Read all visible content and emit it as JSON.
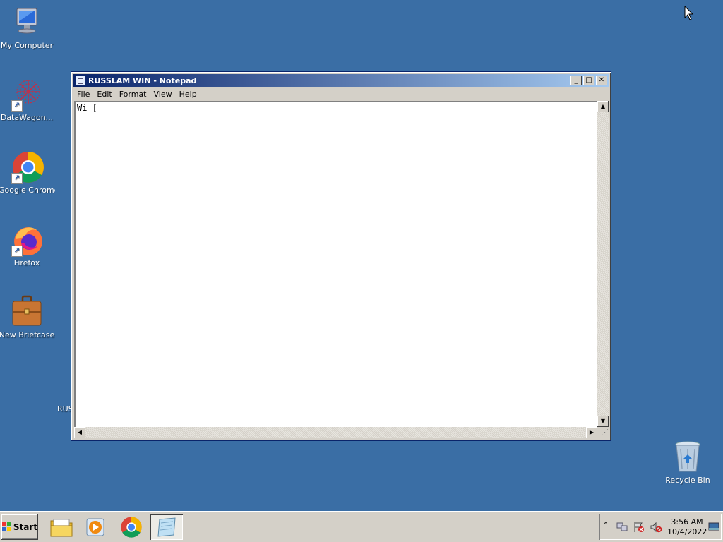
{
  "desktop": {
    "icons": [
      {
        "label": "My Computer",
        "icon": "computer-icon"
      },
      {
        "label": "DataWagon...",
        "icon": "datawagon-icon"
      },
      {
        "label": "Google Chrome",
        "icon": "chrome-icon"
      },
      {
        "label": "Firefox",
        "icon": "firefox-icon"
      },
      {
        "label": "New Briefcase",
        "icon": "briefcase-icon"
      },
      {
        "label": "Recycle Bin",
        "icon": "recycle-bin-icon"
      }
    ],
    "partial_label": "RUS",
    "background_color": "#3a6ea5"
  },
  "notepad": {
    "title": "RUSSLAM WIN - Notepad",
    "menu": [
      "File",
      "Edit",
      "Format",
      "View",
      "Help"
    ],
    "content": "Wi [",
    "title_buttons": {
      "minimize": "_",
      "maximize": "□",
      "close": "✕"
    }
  },
  "taskbar": {
    "start_label": "Start",
    "items": [
      {
        "name": "explorer",
        "icon": "folder-icon",
        "active": false
      },
      {
        "name": "media-player",
        "icon": "media-player-icon",
        "active": false
      },
      {
        "name": "chrome",
        "icon": "chrome-icon",
        "active": false
      },
      {
        "name": "notepad",
        "icon": "notepad-icon",
        "active": true
      }
    ],
    "tray": {
      "expand_glyph": "˄",
      "time": "3:56 AM",
      "date": "10/4/2022"
    }
  }
}
